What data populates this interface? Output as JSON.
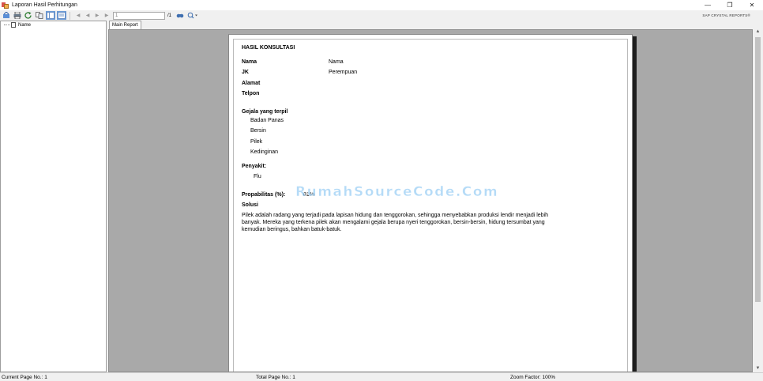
{
  "window": {
    "title": "Laporan Hasil Perhitungan"
  },
  "toolbar": {
    "page_value": "1",
    "page_total": "/1",
    "brand": "SAP CRYSTAL REPORTS®"
  },
  "tree": {
    "root_label": "Name"
  },
  "tabs": [
    {
      "label": "Main Report"
    }
  ],
  "report": {
    "heading": "HASIL KONSULTASI",
    "fields": [
      {
        "label": "Nama",
        "value": "Nama"
      },
      {
        "label": "JK",
        "value": "Perempuan"
      },
      {
        "label": "Alamat",
        "value": ""
      },
      {
        "label": "Telpon",
        "value": ""
      }
    ],
    "symptoms_label": "Gejala yang terpil",
    "symptoms": [
      "Badan Panas",
      "Bersin",
      "Pilek",
      "Kedinginan"
    ],
    "disease_label": "Penyakit:",
    "disease": "Flu",
    "probability_label": "Propabilitas (%):",
    "probability_value": "81%",
    "solution_label": "Solusi",
    "solution_text": "Pilek adalah radang yang terjadi pada lapisan hidung dan tenggorokan, sehingga menyebabkan produksi lendir menjadi lebih banyak. Mereka yang terkena pilek akan mengalami gejala berupa nyeri tenggorokan, bersin-bersin, hidung tersumbat yang kemudian beringus, bahkan batuk-batuk.",
    "watermark": "RumahSourceCode.Com"
  },
  "status": {
    "current_page": "Current Page No.: 1",
    "total_page": "Total Page No.: 1",
    "zoom": "Zoom Factor: 100%"
  },
  "colors": {
    "viewer_bg": "#a9a9a9",
    "watermark": "#78bef0",
    "active_tool": "#d7e6f8"
  }
}
